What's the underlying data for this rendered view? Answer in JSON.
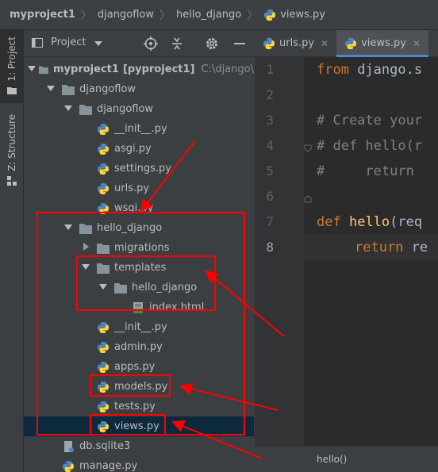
{
  "breadcrumb": {
    "items": [
      "myproject1",
      "djangoflow",
      "hello_django",
      "views.py"
    ]
  },
  "tool_strip": {
    "project_label": "1: Project",
    "structure_label": "Z: Structure"
  },
  "project_panel": {
    "title": "Project",
    "tree": [
      {
        "label": "myproject1",
        "bold_part": "[pyproject1]",
        "path": "C:\\django\\",
        "kind": "folder",
        "expanded": true
      },
      {
        "label": "djangoflow",
        "kind": "folder",
        "expanded": true
      },
      {
        "label": "djangoflow",
        "kind": "folder",
        "expanded": true
      },
      {
        "label": "__init__.py",
        "kind": "py"
      },
      {
        "label": "asgi.py",
        "kind": "py"
      },
      {
        "label": "settings.py",
        "kind": "py"
      },
      {
        "label": "urls.py",
        "kind": "py"
      },
      {
        "label": "wsgi.py",
        "kind": "py"
      },
      {
        "label": "hello_django",
        "kind": "folder",
        "expanded": true
      },
      {
        "label": "migrations",
        "kind": "folder",
        "expanded": false
      },
      {
        "label": "templates",
        "kind": "folder",
        "expanded": true
      },
      {
        "label": "hello_django",
        "kind": "folder",
        "expanded": true
      },
      {
        "label": "index.html",
        "kind": "html"
      },
      {
        "label": "__init__.py",
        "kind": "py"
      },
      {
        "label": "admin.py",
        "kind": "py"
      },
      {
        "label": "apps.py",
        "kind": "py"
      },
      {
        "label": "models.py",
        "kind": "py"
      },
      {
        "label": "tests.py",
        "kind": "py"
      },
      {
        "label": "views.py",
        "kind": "py",
        "selected": true
      },
      {
        "label": "db.sqlite3",
        "kind": "db"
      },
      {
        "label": "manage.py",
        "kind": "py"
      }
    ]
  },
  "editor": {
    "tabs": [
      {
        "label": "urls.py",
        "active": false
      },
      {
        "label": "views.py",
        "active": true
      }
    ],
    "line_numbers": [
      "1",
      "2",
      "3",
      "4",
      "5",
      "6",
      "7",
      "8"
    ],
    "current_line": "8",
    "code": {
      "line1_kw": "from",
      "line1_rest": " django.s",
      "line3": "# Create your",
      "line4": "# def hello(r",
      "line5": "#     return",
      "line7_kw": "def",
      "line7_fn": "hello",
      "line7_rest": "(req",
      "line8_kw": "return",
      "line8_rest": " re"
    },
    "status_text": "hello()"
  },
  "colors": {
    "accent": "#4a88c7",
    "annotation": "#ff0000",
    "keyword": "#cc7832",
    "comment": "#808080",
    "function": "#ffc66d"
  },
  "icons": {
    "folder": "folder-icon",
    "python": "python-file-icon",
    "html": "html-file-icon",
    "database": "database-icon"
  }
}
